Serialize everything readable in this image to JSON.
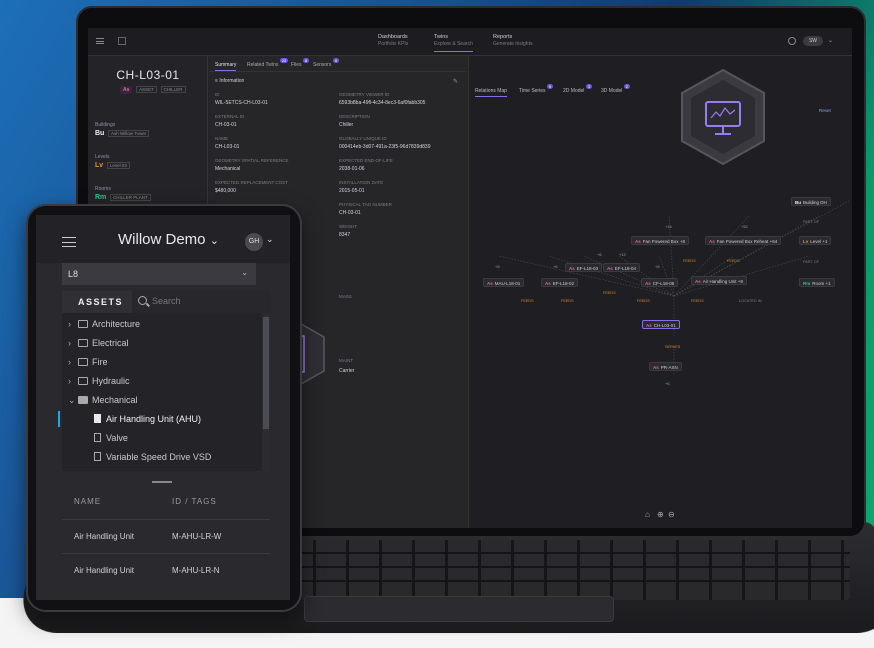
{
  "laptop": {
    "nav": [
      {
        "title": "Dashboards",
        "subtitle": "Portfolio KPIs"
      },
      {
        "title": "Twins",
        "subtitle": "Explore & Search"
      },
      {
        "title": "Reports",
        "subtitle": "Generate Insights"
      }
    ],
    "user_initials": "SW",
    "left_panel": {
      "twin_name": "CH-L03-01",
      "model_badge": "As",
      "tag1": "ASSET",
      "tag2": "CHILLER",
      "buildings_label": "Buildings",
      "building_badge": "Bu",
      "building_value": "Ash Willow Tower",
      "levels_label": "Levels",
      "level_badge": "Lv",
      "level_value": "Level 03",
      "rooms_label": "Rooms",
      "room_badge": "Rm",
      "room_value": "CHILLER PLANT"
    },
    "tabs": [
      {
        "label": "Summary",
        "count": ""
      },
      {
        "label": "Related Twins",
        "count": "23"
      },
      {
        "label": "Files",
        "count": "6"
      },
      {
        "label": "Sensors",
        "count": "9"
      }
    ],
    "section": "Information",
    "fields_left": [
      {
        "label": "ID",
        "value": "WIL-5ETCS-CH-L03-01"
      },
      {
        "label": "EXTERNAL ID",
        "value": "CH-03-01"
      },
      {
        "label": "NAME",
        "value": "CH-L03-01"
      },
      {
        "label": "GEOMETRY SPATIAL REFERENCE",
        "value": "Mechanical"
      },
      {
        "label": "EXPECTED REPLACEMENT COST",
        "value": "$480,000"
      }
    ],
    "fields_right": [
      {
        "label": "GEOMETRY VIEWER ID",
        "value": "6593b8ba-49fl-4c34-8ec3-6af0fabb305"
      },
      {
        "label": "DESCRIPTION",
        "value": "Chiller"
      },
      {
        "label": "GLOBALLY UNIQUE ID",
        "value": "000414eb-3d07-491a-23f5-96d7839d839"
      },
      {
        "label": "EXPECTED END-OF-LIFE",
        "value": "2038-01-06"
      },
      {
        "label": "INSTALLATION DATE",
        "value": "2015-05-01"
      },
      {
        "label": "PHYSICAL TAG NUMBER",
        "value": "CH-03-01"
      },
      {
        "label": "WEIGHT",
        "value": "8347"
      }
    ],
    "mass_label": "MASS",
    "mass_value": "",
    "maint_label": "MAINT",
    "maint_value": "Carrier",
    "right_tabs": [
      {
        "label": "Relations Map",
        "count": ""
      },
      {
        "label": "Time Series",
        "count": "9"
      },
      {
        "label": "2D Model",
        "count": "3"
      },
      {
        "label": "3D Model",
        "count": "2"
      }
    ],
    "reset_label": "Reset",
    "graph": {
      "top_counts": [
        "+16",
        "+52"
      ],
      "fan_nodes": [
        {
          "badge": "As",
          "label": "Fan Powered Box",
          "count": "+8"
        },
        {
          "badge": "As",
          "label": "Fan Powered Box Reheat",
          "count": "+64"
        }
      ],
      "level_node": {
        "badge": "Lv",
        "label": "Level",
        "count": "+1"
      },
      "building_node": {
        "badge": "Bu",
        "label": "Building DH"
      },
      "room_node": {
        "badge": "Rm",
        "label": "Room",
        "count": "+1"
      },
      "mid_nodes": [
        {
          "badge": "As",
          "label": "MAU-L18-01"
        },
        {
          "badge": "As",
          "label": "EF-L18-02"
        },
        {
          "badge": "As",
          "label": "EF-L18-03"
        },
        {
          "badge": "As",
          "label": "EF-L18-04"
        },
        {
          "badge": "As",
          "label": "CF-L18-05"
        },
        {
          "badge": "As",
          "label": "Air Handling Unit",
          "count": "+9"
        }
      ],
      "small_counts": [
        "+8",
        "+6",
        "+7",
        "+12",
        "+8",
        "+6"
      ],
      "center": {
        "badge": "As",
        "label": "CH-L03-01"
      },
      "bottom": {
        "badge": "As",
        "label": "PR-ASN"
      },
      "bottom_count": "+6",
      "edge_feeds": "FEEDS",
      "edge_serves": "SERVES",
      "edge_located": "LOCATED IN",
      "edge_partof": "PART OF"
    }
  },
  "tablet": {
    "title": "Willow Demo",
    "title_chevron": "⌄",
    "avatar": "GH",
    "level_value": "L8",
    "assets_label": "ASSETS",
    "search_placeholder": "Search",
    "tree": [
      {
        "label": "Architecture",
        "type": "folder",
        "expanded": false
      },
      {
        "label": "Electrical",
        "type": "folder",
        "expanded": false
      },
      {
        "label": "Fire",
        "type": "folder",
        "expanded": false
      },
      {
        "label": "Hydraulic",
        "type": "folder",
        "expanded": false
      },
      {
        "label": "Mechanical",
        "type": "folder",
        "expanded": true
      },
      {
        "label": "Air Handling Unit (AHU)",
        "type": "item",
        "selected": true
      },
      {
        "label": "Valve",
        "type": "item",
        "selected": false
      },
      {
        "label": "Variable Speed Drive VSD",
        "type": "item",
        "selected": false
      }
    ],
    "table_headers": [
      "NAME",
      "ID / TAGS"
    ],
    "table_rows": [
      {
        "name": "Air Handling Unit",
        "id": "M-AHU-LR-W"
      },
      {
        "name": "Air Handling Unit",
        "id": "M-AHU-LR-N"
      }
    ]
  },
  "colors": {
    "accent": "#8b6cf0",
    "asset": "#e2649c",
    "level": "#e0922e",
    "room": "#2fc48f",
    "selection": "#1ea7e8"
  }
}
